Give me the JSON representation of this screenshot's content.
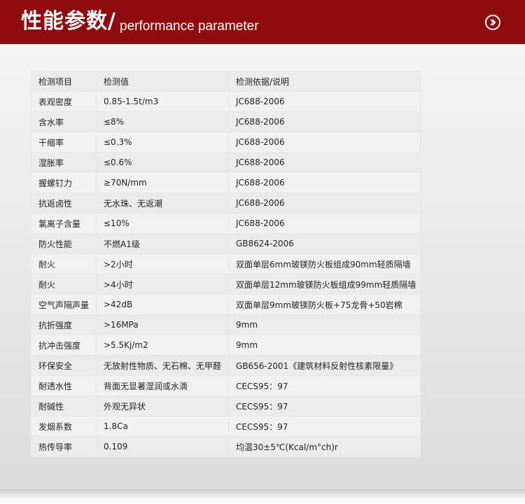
{
  "header": {
    "title_cn": "性能参数/",
    "title_en": "performance parameter"
  },
  "table": {
    "columns": [
      "检测项目",
      "检测值",
      "检测依据/说明"
    ],
    "rows": [
      [
        "表观密度",
        "0.85-1.5t/m3",
        "JC688-2006"
      ],
      [
        "含水率",
        "≤8%",
        "JC688-2006"
      ],
      [
        "干缩率",
        "≤0.3%",
        "JC688-2006"
      ],
      [
        "湿胀率",
        "≤0.6%",
        "JC688-2006"
      ],
      [
        "握螺钉力",
        "≥70N/mm",
        "JC688-2006"
      ],
      [
        "抗返卤性",
        "无水珠、无返潮",
        "JC688-2006"
      ],
      [
        "氯离子含量",
        "≤10%",
        "JC688-2006"
      ],
      [
        "防火性能",
        "不燃A1级",
        "GB8624-2006"
      ],
      [
        "耐火",
        ">2小时",
        "双面单层6mm玻镁防火板组成90mm轻质隔墙"
      ],
      [
        "耐火",
        ">4小时",
        "双面单层12mm玻镁防火板组成99mm轻质隔墙"
      ],
      [
        "空气声隔声量",
        ">42dB",
        "双面单层9mm玻镁防火板+75龙骨+50岩棉"
      ],
      [
        "抗折强度",
        ">16MPa",
        "9mm"
      ],
      [
        "抗冲击强度",
        ">5.5Kj/m2",
        "9mm"
      ],
      [
        "环保安全",
        "无放射性物质、无石棉、无甲醛",
        "GB656-2001《建筑材料反射性核素限量》"
      ],
      [
        "耐透水性",
        "背面无显著湿润或水滴",
        "CECS95：97"
      ],
      [
        "耐碱性",
        "外观无异状",
        "CECS95：97"
      ],
      [
        "发烟系数",
        "1.8Ca",
        "CECS95：97"
      ],
      [
        "热传导率",
        "0.109",
        "均温30±5℃(Kcal/m°ch)r"
      ]
    ]
  },
  "icons": {
    "header_arrow": "chevron-right-circle-icon"
  },
  "colors": {
    "header_bg": "#900b0e",
    "row_odd": "#ebebeb",
    "row_even": "#f1f1f1"
  }
}
